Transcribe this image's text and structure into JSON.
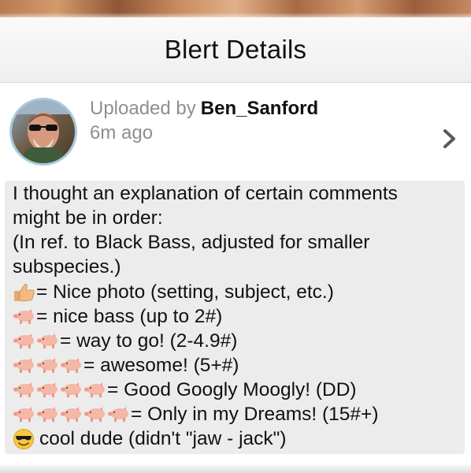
{
  "nav": {
    "title": "Blert Details"
  },
  "post": {
    "uploaded_by_label": "Uploaded by",
    "uploader_name": "Ben_Sanford",
    "time_ago": "6m ago"
  },
  "body": {
    "lines": [
      "I thought an explanation of certain comments",
      "might be in order:",
      "(In ref. to Black Bass, adjusted for smaller",
      "subspecies.)"
    ],
    "legend": [
      {
        "icon": "thumbs-up-icon",
        "count": 1,
        "text": "= Nice photo (setting, subject, etc.)"
      },
      {
        "icon": "pig-icon",
        "count": 1,
        "text": " = nice bass (up to 2#)"
      },
      {
        "icon": "pig-icon",
        "count": 2,
        "text": "= way to go! (2-4.9#)"
      },
      {
        "icon": "pig-icon",
        "count": 3,
        "text": "= awesome! (5+#)"
      },
      {
        "icon": "pig-icon",
        "count": 4,
        "text": "= Good Googly Moogly! (DD)"
      },
      {
        "icon": "pig-icon",
        "count": 5,
        "text": "= Only in my Dreams! (15#+)"
      },
      {
        "icon": "sunglasses-face-icon",
        "count": 1,
        "text": "cool dude (didn't \"jaw - jack\")"
      }
    ]
  },
  "colors": {
    "avatar_ring": "#a8c9dd",
    "body_background": "#ececec",
    "secondary_text": "#8e8e8e"
  }
}
